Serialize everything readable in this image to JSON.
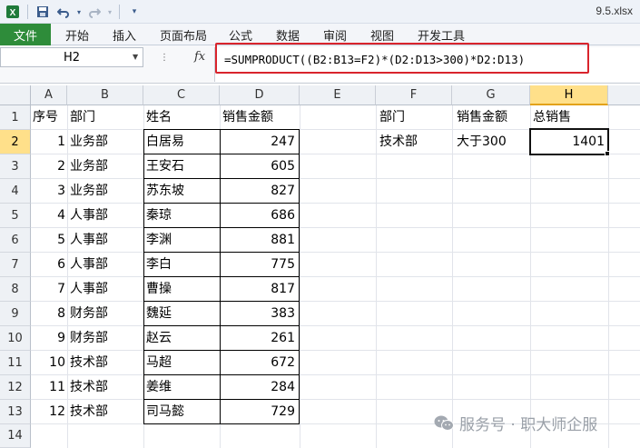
{
  "window": {
    "filename": "9.5.xlsx"
  },
  "ribbon": {
    "file_tab": "文件",
    "tabs": [
      "开始",
      "插入",
      "页面布局",
      "公式",
      "数据",
      "审阅",
      "视图",
      "开发工具"
    ]
  },
  "formula_bar": {
    "name_box": "H2",
    "fx_label": "fx",
    "formula": "=SUMPRODUCT((B2:B13=F2)*(D2:D13>300)*D2:D13)"
  },
  "sheet": {
    "columns": [
      "A",
      "B",
      "C",
      "D",
      "E",
      "F",
      "G",
      "H"
    ],
    "rows": [
      "1",
      "2",
      "3",
      "4",
      "5",
      "6",
      "7",
      "8",
      "9",
      "10",
      "11",
      "12",
      "13",
      "14"
    ],
    "headers": {
      "a": "序号",
      "b": "部门",
      "c": "姓名",
      "d": "销售金额"
    },
    "data": [
      {
        "no": "1",
        "dept": "业务部",
        "name": "白居易",
        "amount": "247"
      },
      {
        "no": "2",
        "dept": "业务部",
        "name": "王安石",
        "amount": "605"
      },
      {
        "no": "3",
        "dept": "业务部",
        "name": "苏东坡",
        "amount": "827"
      },
      {
        "no": "4",
        "dept": "人事部",
        "name": "秦琼",
        "amount": "686"
      },
      {
        "no": "5",
        "dept": "人事部",
        "name": "李渊",
        "amount": "881"
      },
      {
        "no": "6",
        "dept": "人事部",
        "name": "李白",
        "amount": "775"
      },
      {
        "no": "7",
        "dept": "人事部",
        "name": "曹操",
        "amount": "817"
      },
      {
        "no": "8",
        "dept": "财务部",
        "name": "魏延",
        "amount": "383"
      },
      {
        "no": "9",
        "dept": "财务部",
        "name": "赵云",
        "amount": "261"
      },
      {
        "no": "10",
        "dept": "技术部",
        "name": "马超",
        "amount": "672"
      },
      {
        "no": "11",
        "dept": "技术部",
        "name": "姜维",
        "amount": "284"
      },
      {
        "no": "12",
        "dept": "技术部",
        "name": "司马懿",
        "amount": "729"
      }
    ],
    "criteria": {
      "f1": "部门",
      "g1": "销售金额",
      "h1": "总销售",
      "f2": "技术部",
      "g2": "大于300",
      "h2": "1401"
    }
  },
  "watermark": {
    "text": "服务号 · 职大师企服"
  },
  "colors": {
    "file_tab": "#2e8c3a",
    "highlight_border": "#d9242c",
    "selected_header": "#ffe08a"
  }
}
